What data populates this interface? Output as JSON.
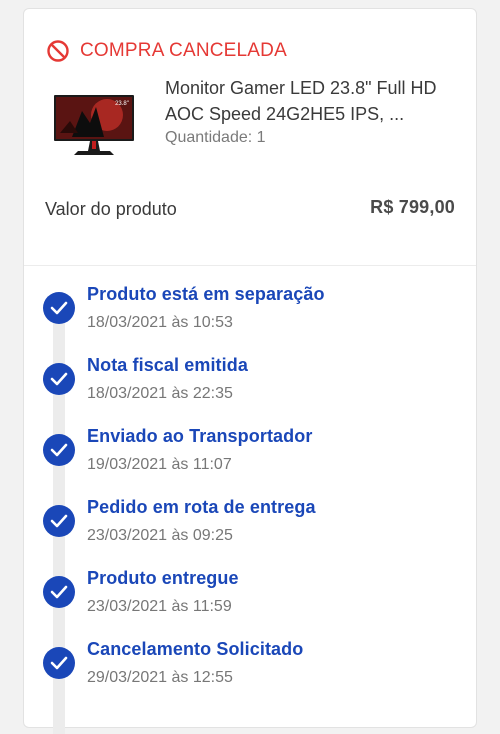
{
  "order": {
    "status_text": "COMPRA CANCELADA",
    "status_icon": "prohibited-icon",
    "status_color": "#e53935",
    "product": {
      "name": "Monitor Gamer LED 23.8\" Full HD AOC Speed 24G2HE5 IPS, ...",
      "quantity_text": "Quantidade: 1",
      "image_badge": "23.8\""
    },
    "price_label": "Valor do produto",
    "price_value": "R$ 799,00"
  },
  "timeline": {
    "accent_color": "#1a47b8",
    "steps": [
      {
        "title": "Produto está em separação",
        "date": "18/03/2021 às 10:53"
      },
      {
        "title": "Nota fiscal emitida",
        "date": "18/03/2021 às 22:35"
      },
      {
        "title": "Enviado ao Transportador",
        "date": "19/03/2021 às 11:07"
      },
      {
        "title": "Pedido em rota de entrega",
        "date": "23/03/2021 às 09:25"
      },
      {
        "title": "Produto entregue",
        "date": "23/03/2021 às 11:59"
      },
      {
        "title": "Cancelamento Solicitado",
        "date": "29/03/2021 às 12:55"
      }
    ]
  }
}
